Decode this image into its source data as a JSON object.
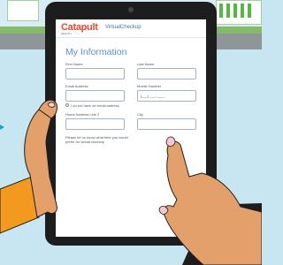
{
  "app": {
    "logo_main": "Catapult",
    "logo_sub": "HEALTH",
    "logo_suffix": "VirtualCheckup"
  },
  "form": {
    "title": "My Information",
    "first_name_label": "First Name",
    "last_name_label": "Last Name",
    "email_label": "Email Address",
    "mobile_label": "Mobile Number",
    "mobile_value": "(___) ___-____",
    "no_email_label": "I do not have an email address",
    "home_address_label": "Home Address Line 2",
    "city_label": "City",
    "preferred_time_label": "Please let us know what time you would prefer for virtual checkup"
  },
  "colors": {
    "brand": "#e2492f",
    "title": "#5d8fcf",
    "field_border": "#9fb3cc",
    "skin": "#e4a06b",
    "sleeve": "#f39a1e"
  }
}
